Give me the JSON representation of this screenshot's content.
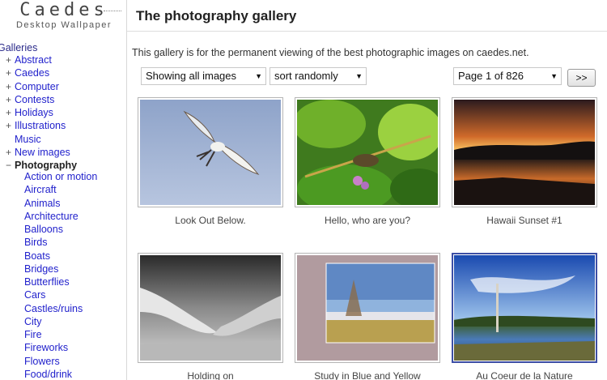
{
  "logo": {
    "title": "Caedes",
    "subtitle": "Desktop Wallpaper"
  },
  "sidebar": {
    "heading": "Galleries",
    "items": [
      {
        "mark": "+",
        "label": "Abstract"
      },
      {
        "mark": "+",
        "label": "Caedes"
      },
      {
        "mark": "+",
        "label": "Computer"
      },
      {
        "mark": "+",
        "label": "Contests"
      },
      {
        "mark": "+",
        "label": "Holidays"
      },
      {
        "mark": "+",
        "label": "Illustrations"
      },
      {
        "mark": "",
        "label": "Music"
      },
      {
        "mark": "+",
        "label": "New images"
      },
      {
        "mark": "−",
        "label": "Photography"
      }
    ],
    "subitems": [
      "Action or motion",
      "Aircraft",
      "Animals",
      "Architecture",
      "Balloons",
      "Birds",
      "Boats",
      "Bridges",
      "Butterflies",
      "Cars",
      "Castles/ruins",
      "City",
      "Fire",
      "Fireworks",
      "Flowers",
      "Food/drink"
    ]
  },
  "main": {
    "title": "The photography gallery",
    "intro": "This gallery is for the permanent viewing of the best photographic images on caedes.net.",
    "filters": {
      "showing": "Showing all images",
      "sort": "sort randomly",
      "page": "Page 1 of 826",
      "next": ">>"
    },
    "thumbnails": [
      {
        "caption": "Look Out Below."
      },
      {
        "caption": "Hello, who are you?"
      },
      {
        "caption": "Hawaii Sunset #1"
      },
      {
        "caption": "Holding on"
      },
      {
        "caption": "Study in Blue and Yellow"
      },
      {
        "caption": "Au Coeur de la Nature"
      }
    ]
  }
}
